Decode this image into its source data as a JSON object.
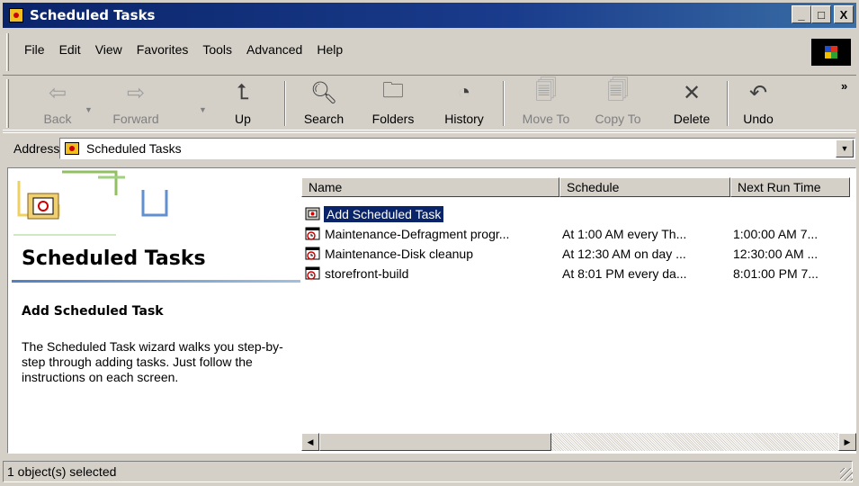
{
  "window": {
    "title": "Scheduled Tasks",
    "controls": [
      "_",
      "□",
      "X"
    ]
  },
  "menu": [
    "File",
    "Edit",
    "View",
    "Favorites",
    "Tools",
    "Advanced",
    "Help"
  ],
  "toolbar": {
    "back": "Back",
    "forward": "Forward",
    "up": "Up",
    "search": "Search",
    "folders": "Folders",
    "history": "History",
    "move_to": "Move To",
    "copy_to": "Copy To",
    "delete": "Delete",
    "undo": "Undo",
    "more": "»"
  },
  "address": {
    "label": "Address",
    "value": "Scheduled Tasks"
  },
  "left_pane": {
    "title": "Scheduled Tasks",
    "subtitle": "Add Scheduled Task",
    "description": "The Scheduled Task wizard walks you step-by-step through adding tasks. Just follow the instructions on each screen."
  },
  "list": {
    "columns": [
      "Name",
      "Schedule",
      "Next Run Time"
    ],
    "rows": [
      {
        "name": "Add Scheduled Task",
        "schedule": "",
        "next": "",
        "selected": true
      },
      {
        "name": "Maintenance-Defragment progr...",
        "schedule": "At 1:00 AM every Th...",
        "next": "1:00:00 AM  7..."
      },
      {
        "name": "Maintenance-Disk cleanup",
        "schedule": "At 12:30 AM on day ...",
        "next": "12:30:00 AM  ..."
      },
      {
        "name": "storefront-build",
        "schedule": "At 8:01 PM every da...",
        "next": "8:01:00 PM  7..."
      }
    ]
  },
  "status": {
    "text": "1 object(s) selected"
  },
  "colors": {
    "title_bar": "#0a246a",
    "selection": "#0a246a",
    "face": "#d4d0c8"
  }
}
